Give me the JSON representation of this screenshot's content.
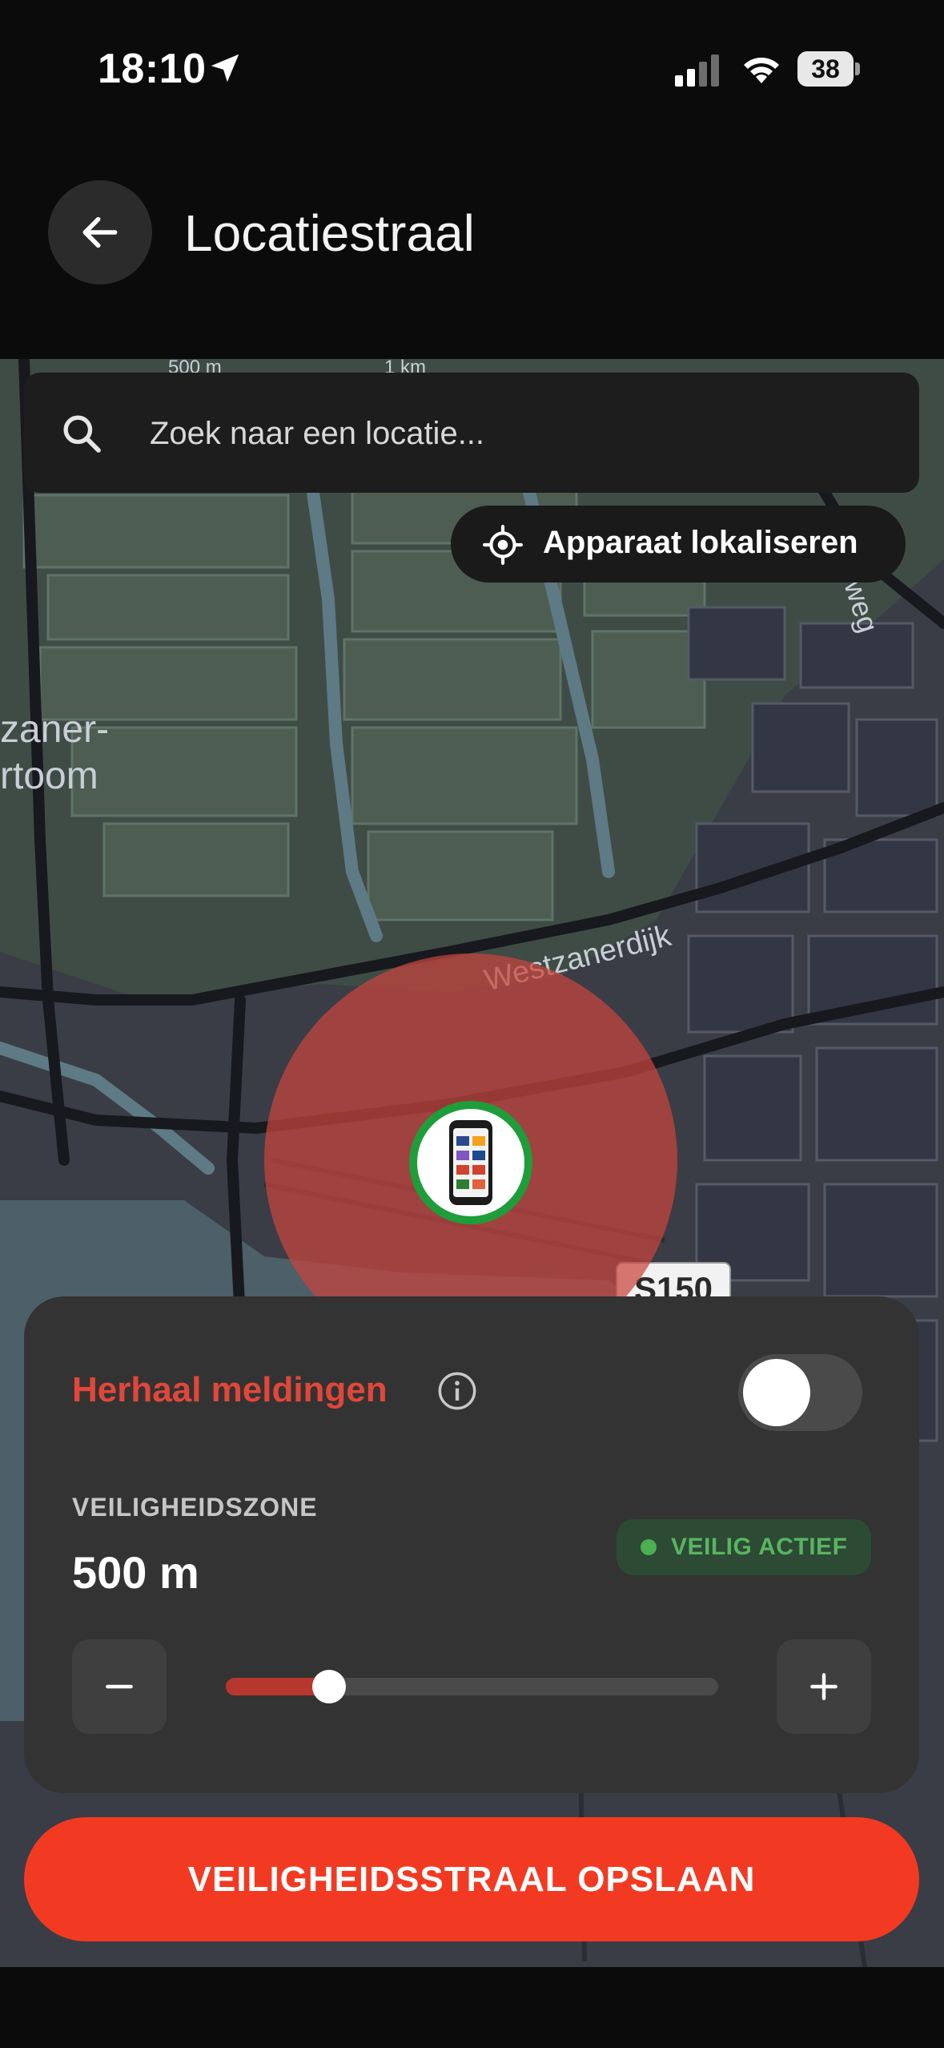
{
  "status_bar": {
    "time": "18:10",
    "battery": "38"
  },
  "header": {
    "title": "Locatiestraal"
  },
  "map": {
    "scale_labels": [
      "500 m",
      "1 km"
    ],
    "labels": [
      "zaner-",
      "rtoom",
      "toom",
      "Westzanerdijk",
      "weg",
      "S150"
    ]
  },
  "search": {
    "placeholder": "Zoek naar een locatie..."
  },
  "locate_button": {
    "label": "Apparaat lokaliseren"
  },
  "panel": {
    "repeat_label": "Herhaal meldingen",
    "repeat_enabled": false,
    "zone_label": "VEILIGHEIDSZONE",
    "zone_value": "500 m",
    "status": "VEILIG ACTIEF",
    "slider_fraction": 0.21
  },
  "save_button": {
    "label": "VEILIGHEIDSSTRAAL OPSLAAN"
  },
  "colors": {
    "accent": "#f23a22",
    "label_red": "#e0473a",
    "status_green": "#58b560",
    "zone_circle": "#c8443d"
  }
}
